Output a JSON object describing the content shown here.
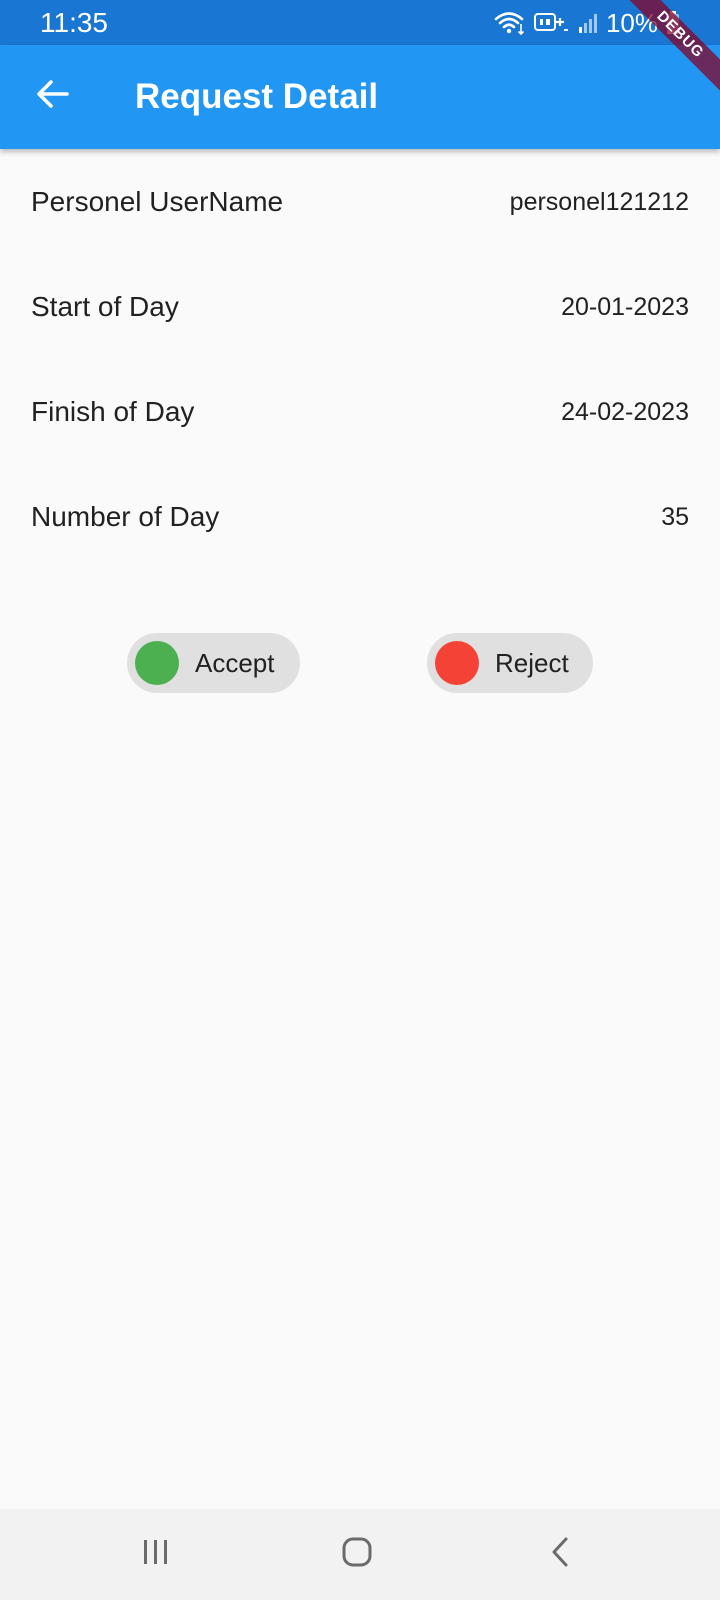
{
  "status_bar": {
    "time": "11:35",
    "battery_text": "10%",
    "icons": [
      "wifi-icon",
      "hd-volte-icon",
      "signal-icon",
      "battery-icon"
    ]
  },
  "debug_banner": "DEBUG",
  "app_bar": {
    "title": "Request Detail",
    "back_icon": "arrow-left-icon",
    "background_color": "#2196f3"
  },
  "details": [
    {
      "label": "Personel UserName",
      "value": "personel121212"
    },
    {
      "label": "Start of Day",
      "value": "20-01-2023"
    },
    {
      "label": "Finish of Day",
      "value": "24-02-2023"
    },
    {
      "label": "Number of Day",
      "value": "35"
    }
  ],
  "actions": {
    "accept": {
      "label": "Accept",
      "color": "#4caf50"
    },
    "reject": {
      "label": "Reject",
      "color": "#f44336"
    }
  },
  "nav_bar": {
    "icons": [
      "recents-icon",
      "home-icon",
      "back-icon"
    ]
  }
}
